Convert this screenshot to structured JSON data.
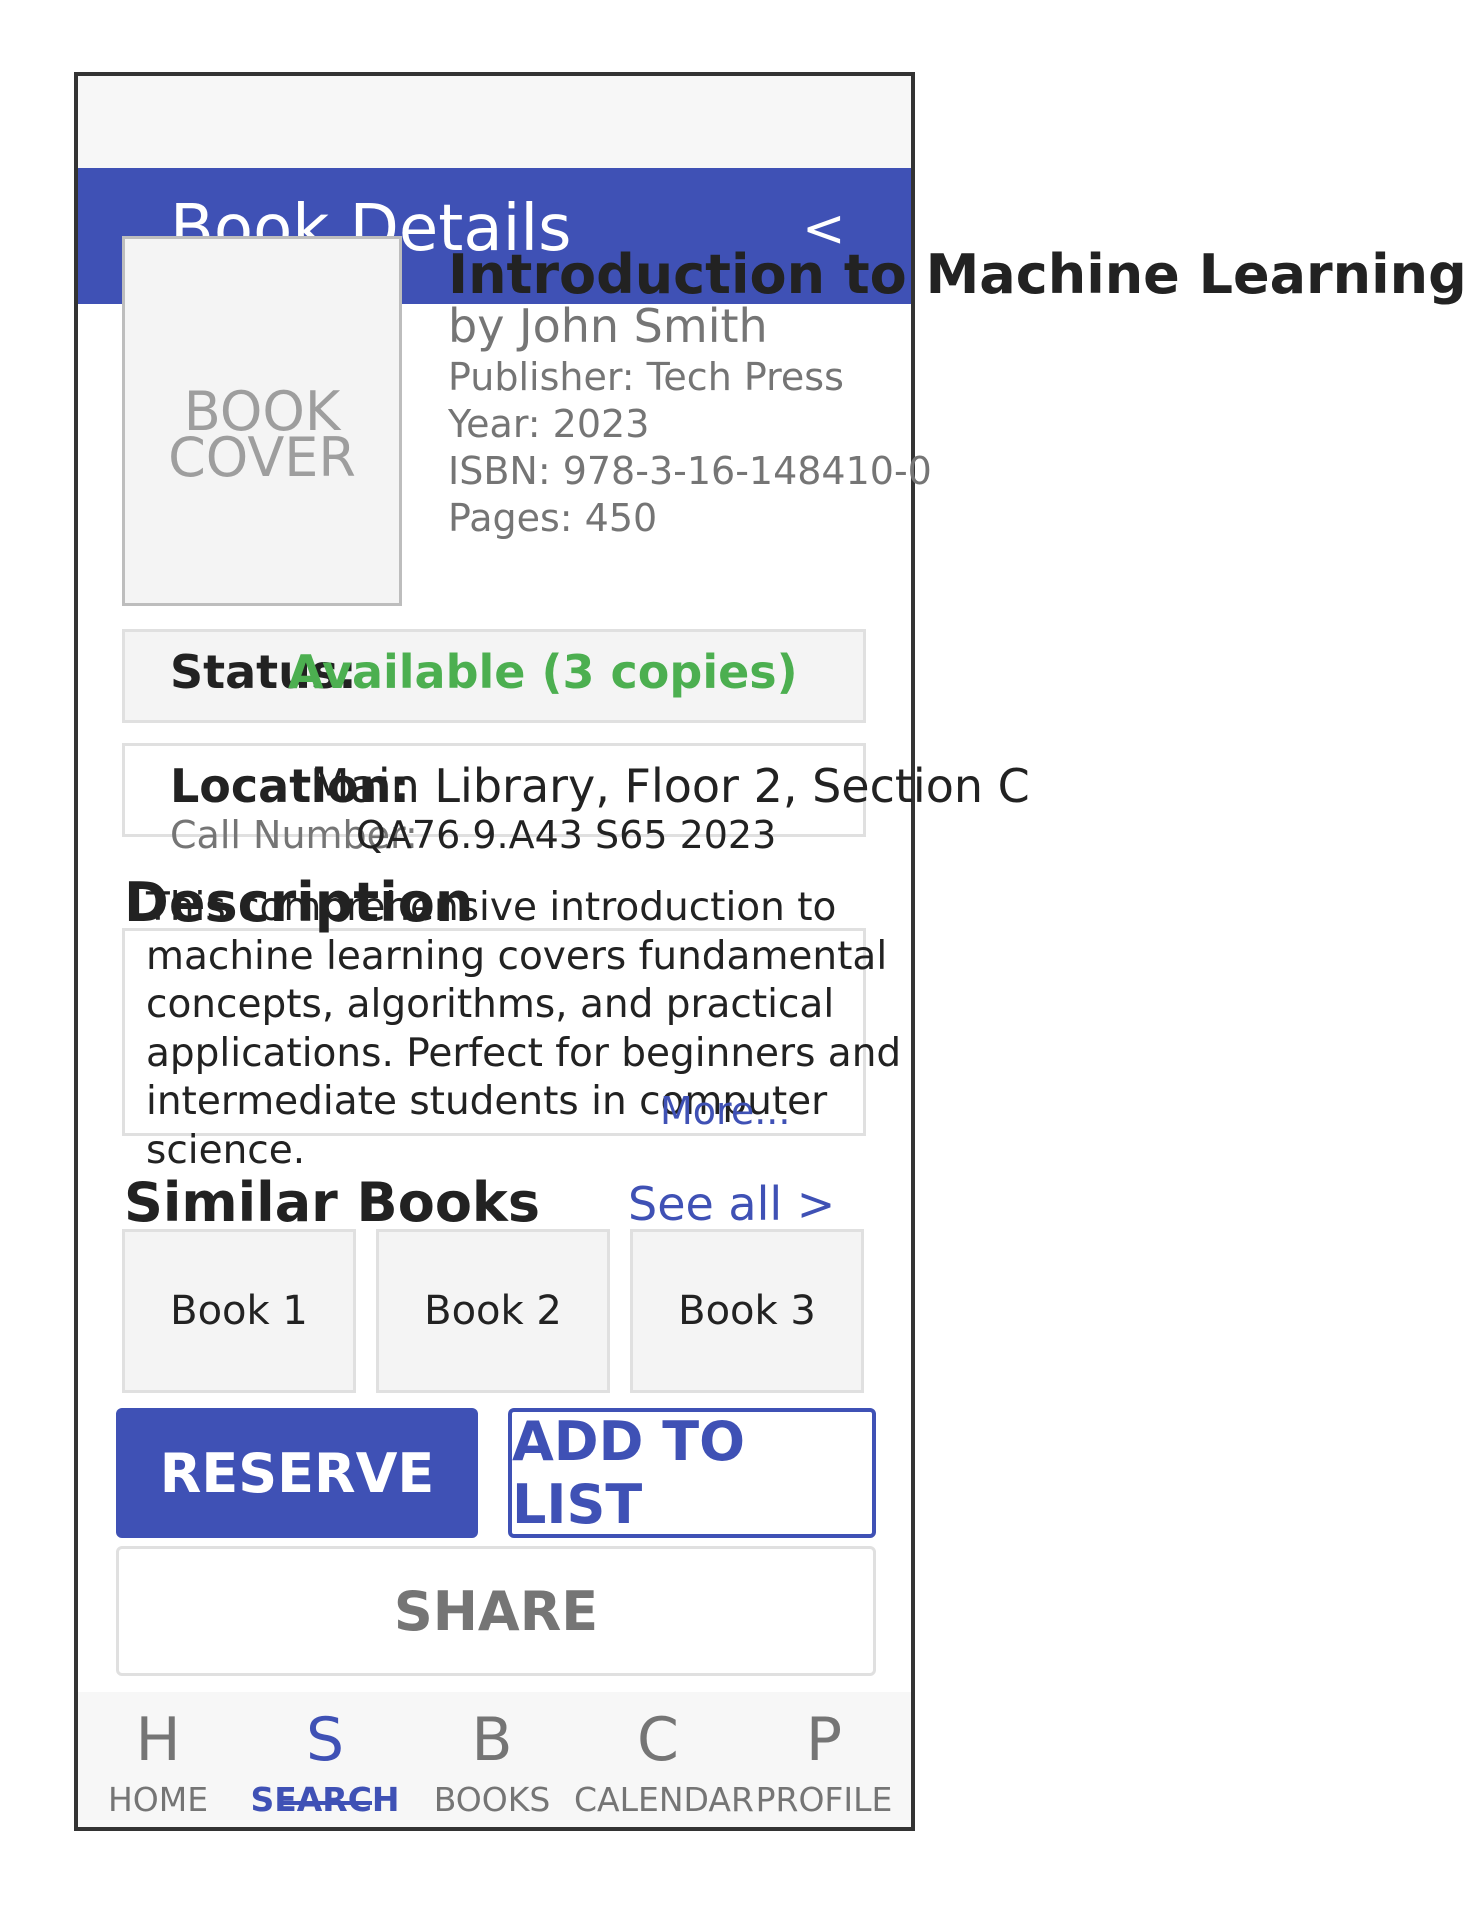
{
  "header": {
    "title": "Book Details",
    "back_label": "<"
  },
  "book": {
    "cover_placeholder": "BOOK\nCOVER",
    "title": "Introduction to Machine Learning",
    "author": "by John Smith",
    "publisher": "Publisher: Tech Press",
    "year": "Year: 2023",
    "isbn": "ISBN: 978-3-16-148410-0",
    "pages": "Pages: 450"
  },
  "availability": {
    "status_label": "Status:",
    "status_value": "Available (3 copies)",
    "location_label": "Location:",
    "location_value": "Main Library, Floor 2, Section C",
    "call_number_label": "Call Number:",
    "call_number_value": "QA76.9.A43 S65 2023"
  },
  "description": {
    "heading": "Description",
    "text": "This comprehensive introduction to\nmachine learning covers fundamental\nconcepts, algorithms, and practical\napplications. Perfect for beginners and\nintermediate students in computer\nscience.",
    "more_label": "More..."
  },
  "similar": {
    "heading": "Similar Books",
    "see_all_label": "See all >",
    "books": [
      "Book 1",
      "Book 2",
      "Book 3"
    ]
  },
  "actions": {
    "reserve_label": "RESERVE",
    "add_to_list_label": "ADD TO LIST",
    "share_label": "SHARE"
  },
  "bottom_nav": {
    "items": [
      {
        "icon": "H",
        "label": "HOME"
      },
      {
        "icon": "S",
        "label": "SEARCH",
        "active": true
      },
      {
        "icon": "B",
        "label": "BOOKS"
      },
      {
        "icon": "C",
        "label": "CALENDAR"
      },
      {
        "icon": "P",
        "label": "PROFILE"
      }
    ]
  },
  "colors": {
    "primary": "#3f51b5",
    "available": "#4caf50",
    "muted_text": "#757575"
  }
}
